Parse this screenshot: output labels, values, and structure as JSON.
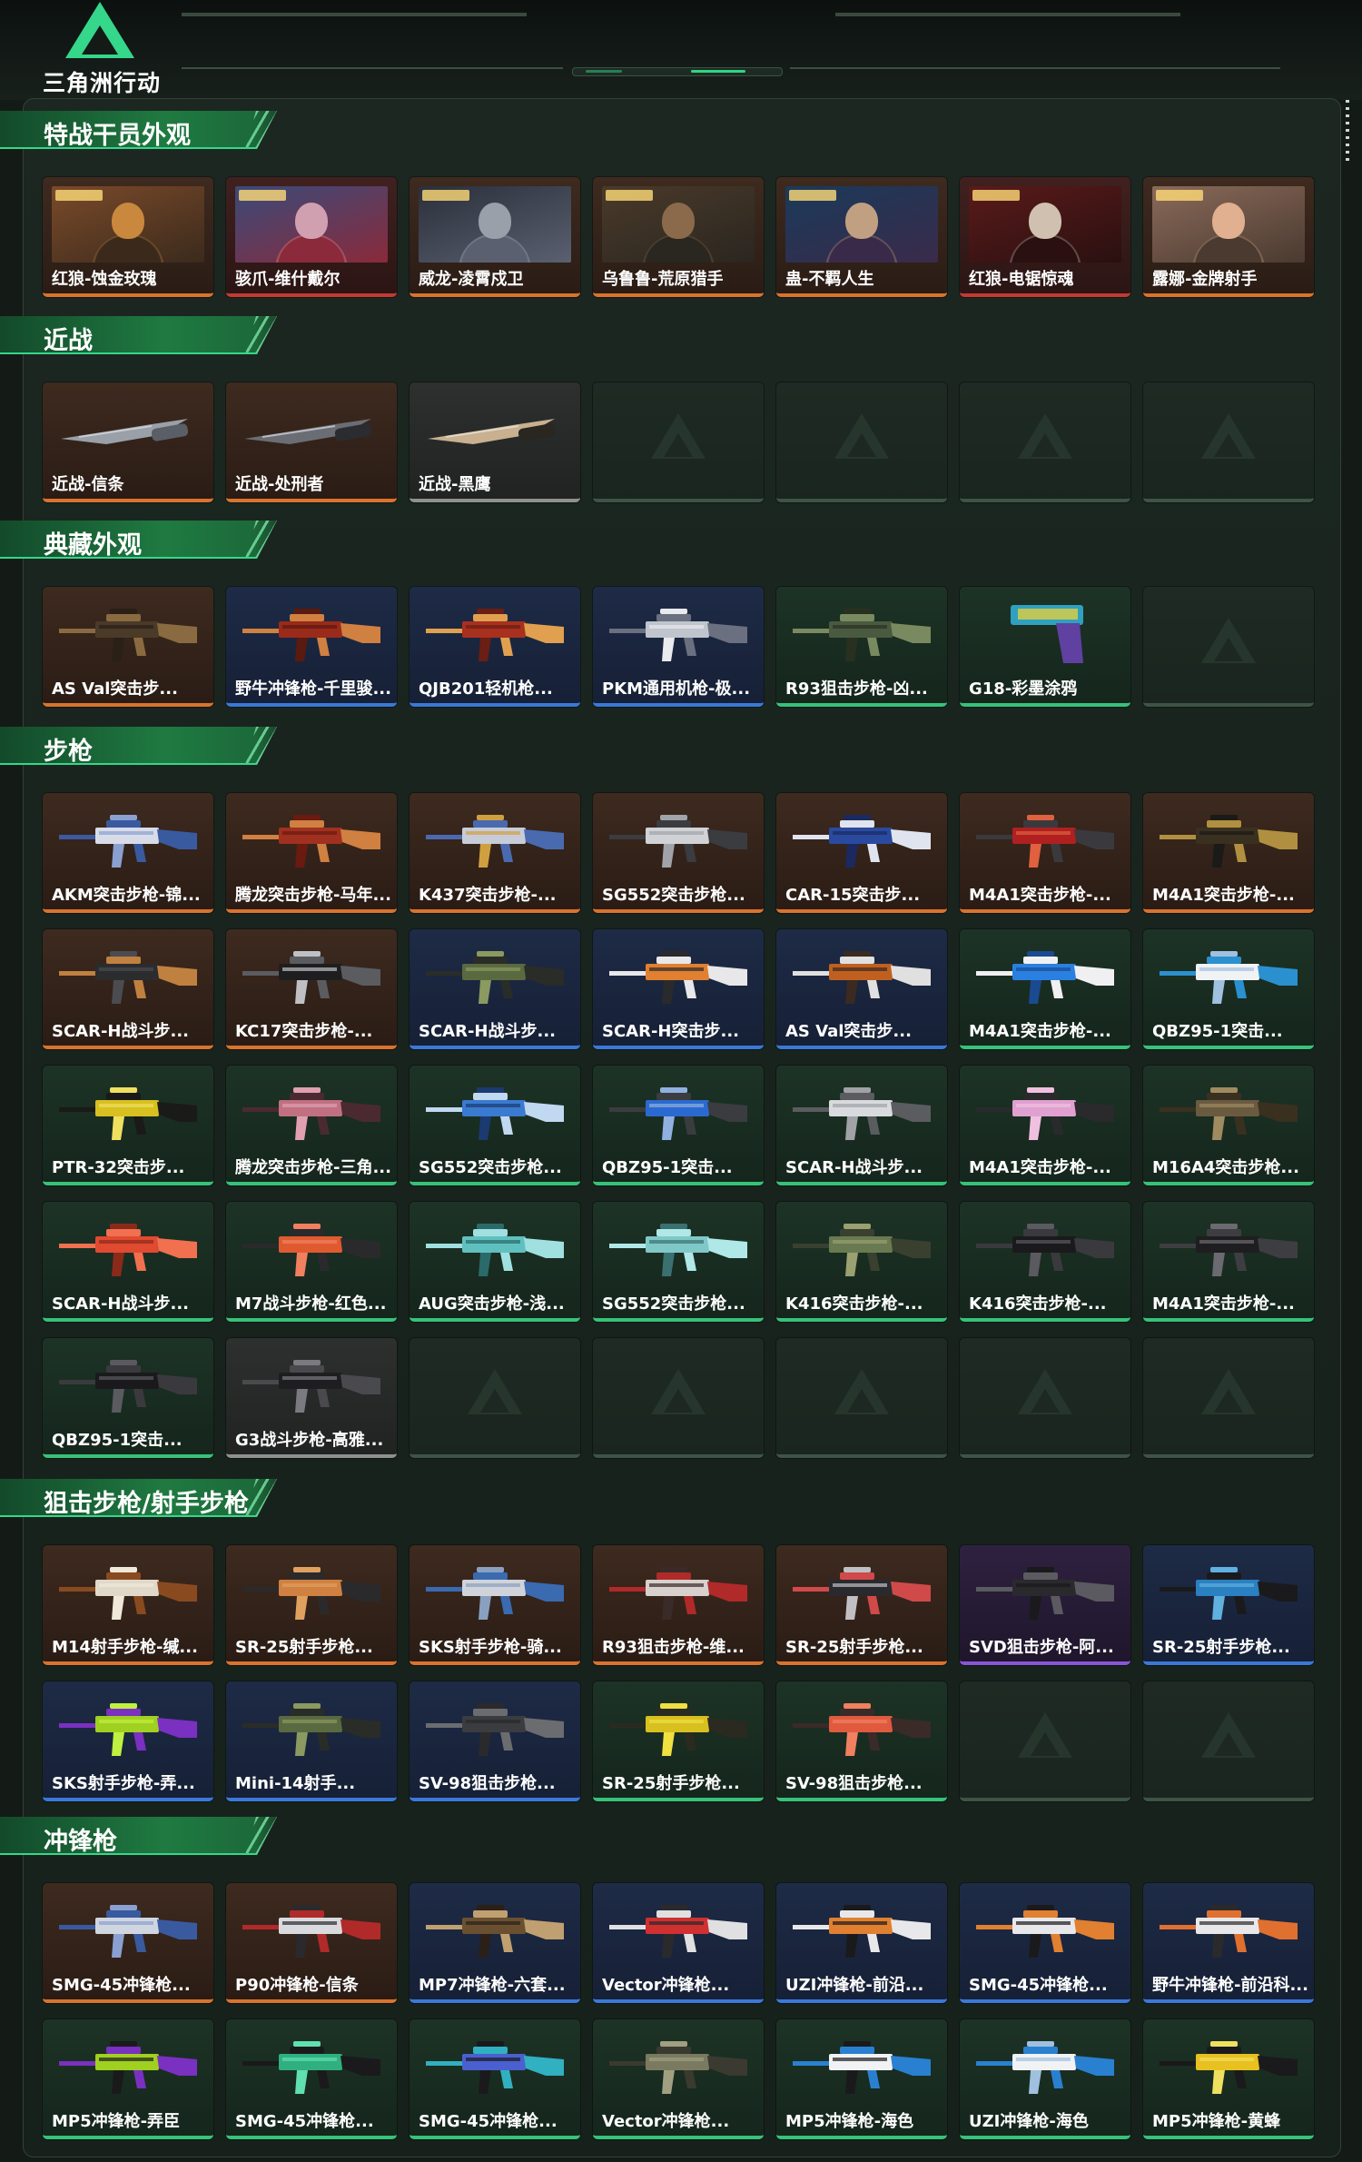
{
  "app": {
    "logo_text": "三角洲行动"
  },
  "colors": {
    "background": "#141b17",
    "accent_green": "#35d78a",
    "quality_orange": "#d9732d",
    "quality_red": "#c23a32",
    "quality_blue": "#3a79d9",
    "quality_purple": "#8a55d9",
    "quality_green": "#37c27a",
    "quality_gray": "#8d928e"
  },
  "sections": [
    {
      "title": "特战干员外观",
      "items": [
        {
          "label": "红狼-蚀金玫瑰",
          "quality": "orange",
          "kind": "operator",
          "art": [
            "#7a4a2a",
            "#c9883e",
            "#3b2a1c"
          ]
        },
        {
          "label": "骇爪-维什戴尔",
          "quality": "red",
          "kind": "operator",
          "art": [
            "#3a4a7a",
            "#d0a0b0",
            "#8a2a3a"
          ]
        },
        {
          "label": "威龙-凌霄戍卫",
          "quality": "orange",
          "kind": "operator",
          "art": [
            "#2a2f3a",
            "#9aa0aa",
            "#5a6070"
          ]
        },
        {
          "label": "乌鲁鲁-荒原猎手",
          "quality": "orange",
          "kind": "operator",
          "art": [
            "#4a3a2a",
            "#8a6a4a",
            "#2a2620"
          ]
        },
        {
          "label": "蛊-不羁人生",
          "quality": "orange",
          "kind": "operator",
          "art": [
            "#1a3a5a",
            "#c0a080",
            "#3a2a4a"
          ]
        },
        {
          "label": "红狼-电锯惊魂",
          "quality": "red",
          "kind": "operator",
          "art": [
            "#5a1a1a",
            "#d0c0b0",
            "#2a1010"
          ]
        },
        {
          "label": "露娜-金牌射手",
          "quality": "orange",
          "kind": "operator",
          "art": [
            "#8a6a5a",
            "#e0b090",
            "#4a3a30"
          ]
        }
      ]
    },
    {
      "title": "近战",
      "items": [
        {
          "label": "近战-信条",
          "quality": "orange",
          "kind": "knife",
          "art": [
            "#9aa0a8",
            "#5a5e66",
            "#c8ccd2"
          ]
        },
        {
          "label": "近战-处刑者",
          "quality": "orange",
          "kind": "knife",
          "art": [
            "#6a6e74",
            "#2a2c30",
            "#b8bcc2"
          ]
        },
        {
          "label": "近战-黑鹰",
          "quality": "gray",
          "kind": "knife",
          "art": [
            "#c8b090",
            "#2a2620",
            "#e0d8c8"
          ]
        },
        {
          "label": "",
          "quality": "empty",
          "kind": "empty"
        },
        {
          "label": "",
          "quality": "empty",
          "kind": "empty"
        },
        {
          "label": "",
          "quality": "empty",
          "kind": "empty"
        },
        {
          "label": "",
          "quality": "empty",
          "kind": "empty"
        }
      ]
    },
    {
      "title": "典藏外观",
      "items": [
        {
          "label": "AS Val突击步...",
          "quality": "orange",
          "kind": "gun",
          "art": [
            "#4a3a28",
            "#8a6a40",
            "#2a2018"
          ]
        },
        {
          "label": "野牛冲锋枪-千里骏...",
          "quality": "blue",
          "kind": "gun",
          "art": [
            "#9a2a1a",
            "#d08040",
            "#5a1a10"
          ]
        },
        {
          "label": "QJB201轻机枪...",
          "quality": "blue",
          "kind": "gun",
          "art": [
            "#a8301e",
            "#e0a050",
            "#6a1e14"
          ]
        },
        {
          "label": "PKM通用机枪-极...",
          "quality": "blue",
          "kind": "gun",
          "art": [
            "#c0c4cc",
            "#6a7080",
            "#e8eaee"
          ]
        },
        {
          "label": "R93狙击步枪-凶...",
          "quality": "green",
          "kind": "gun",
          "art": [
            "#4a5a40",
            "#7a8a60",
            "#2a3020"
          ]
        },
        {
          "label": "G18-彩墨涂鸦",
          "quality": "green",
          "kind": "pistol",
          "art": [
            "#30a0c0",
            "#e0d040",
            "#6040a0"
          ]
        },
        {
          "label": "",
          "quality": "empty",
          "kind": "empty"
        }
      ]
    },
    {
      "title": "步枪",
      "items": [
        {
          "label": "AKM突击步枪-锦...",
          "quality": "orange",
          "kind": "gun",
          "art": [
            "#d8dce8",
            "#3a5aa0",
            "#8aa0d0"
          ]
        },
        {
          "label": "腾龙突击步枪-马年...",
          "quality": "orange",
          "kind": "gun",
          "art": [
            "#a03020",
            "#d08040",
            "#6a1a10"
          ]
        },
        {
          "label": "K437突击步枪-...",
          "quality": "orange",
          "kind": "gun",
          "art": [
            "#c8ccd8",
            "#4a6ab0",
            "#d0a040"
          ]
        },
        {
          "label": "SG552突击步枪...",
          "quality": "orange",
          "kind": "gun",
          "art": [
            "#d0d2d6",
            "#3a3c40",
            "#a0a4aa"
          ]
        },
        {
          "label": "CAR-15突击步...",
          "quality": "orange",
          "kind": "gun",
          "art": [
            "#2a4aa0",
            "#e0e4ee",
            "#1a2a60"
          ]
        },
        {
          "label": "M4A1突击步枪-...",
          "quality": "orange",
          "kind": "gun",
          "art": [
            "#b02020",
            "#3a3a3e",
            "#e06040"
          ]
        },
        {
          "label": "M4A1突击步枪-...",
          "quality": "orange",
          "kind": "gun",
          "art": [
            "#3a3020",
            "#b09040",
            "#1a1a18"
          ]
        },
        {
          "label": "SCAR-H战斗步...",
          "quality": "orange",
          "kind": "gun",
          "art": [
            "#2a2c2e",
            "#c08040",
            "#4a4c50"
          ]
        },
        {
          "label": "KC17突击步枪-...",
          "quality": "orange",
          "kind": "gun",
          "art": [
            "#1e1e20",
            "#5a5c60",
            "#c0c0c4"
          ]
        },
        {
          "label": "SCAR-H战斗步...",
          "quality": "blue",
          "kind": "gun",
          "art": [
            "#5a6a40",
            "#2a2c28",
            "#8a9a60"
          ]
        },
        {
          "label": "SCAR-H突击步...",
          "quality": "blue",
          "kind": "gun",
          "art": [
            "#e08030",
            "#e8e8ea",
            "#2a2a2c"
          ]
        },
        {
          "label": "AS Val突击步...",
          "quality": "blue",
          "kind": "gun",
          "art": [
            "#c06020",
            "#e0e0e0",
            "#3a2a20"
          ]
        },
        {
          "label": "M4A1突击步枪-...",
          "quality": "green",
          "kind": "gun",
          "art": [
            "#2a80e0",
            "#f0f0f2",
            "#1a4a90"
          ]
        },
        {
          "label": "QBZ95-1突击...",
          "quality": "green",
          "kind": "gun",
          "art": [
            "#f0f2f4",
            "#2a90d0",
            "#a0c0e0"
          ]
        },
        {
          "label": "PTR-32突击步...",
          "quality": "green",
          "kind": "gun",
          "art": [
            "#d8c020",
            "#1a1a18",
            "#f0e060"
          ]
        },
        {
          "label": "腾龙突击步枪-三角...",
          "quality": "green",
          "kind": "gun",
          "art": [
            "#c07080",
            "#4a2a30",
            "#e0a0b0"
          ]
        },
        {
          "label": "SG552突击步枪...",
          "quality": "green",
          "kind": "gun",
          "art": [
            "#3a7ad0",
            "#c0d8f0",
            "#1a3a70"
          ]
        },
        {
          "label": "QBZ95-1突击...",
          "quality": "green",
          "kind": "gun",
          "art": [
            "#2a6ad0",
            "#3a3c40",
            "#90b0e0"
          ]
        },
        {
          "label": "SCAR-H战斗步...",
          "quality": "green",
          "kind": "gun",
          "art": [
            "#d8dade",
            "#5a5c60",
            "#a0a2a6"
          ]
        },
        {
          "label": "M4A1突击步枪-...",
          "quality": "green",
          "kind": "gun",
          "art": [
            "#e0a0d0",
            "#2a2a2c",
            "#f0c0e0"
          ]
        },
        {
          "label": "M16A4突击步枪...",
          "quality": "green",
          "kind": "gun",
          "art": [
            "#6a5a40",
            "#3a3020",
            "#a08a60"
          ]
        },
        {
          "label": "SCAR-H战斗步...",
          "quality": "green",
          "kind": "gun",
          "art": [
            "#e04a30",
            "#f07050",
            "#8a2a1a"
          ]
        },
        {
          "label": "M7战斗步枪-红色...",
          "quality": "green",
          "kind": "gun",
          "art": [
            "#e05a30",
            "#2a2a2c",
            "#f08060"
          ]
        },
        {
          "label": "AUG突击步枪-浅...",
          "quality": "green",
          "kind": "gun",
          "art": [
            "#60c0c0",
            "#a0e0e0",
            "#2a6a6a"
          ]
        },
        {
          "label": "SG552突击步枪...",
          "quality": "green",
          "kind": "gun",
          "art": [
            "#80c8c8",
            "#b0e8e8",
            "#3a7070"
          ]
        },
        {
          "label": "K416突击步枪-...",
          "quality": "green",
          "kind": "gun",
          "art": [
            "#6a7a50",
            "#3a4030",
            "#9aa070"
          ]
        },
        {
          "label": "K416突击步枪-...",
          "quality": "green",
          "kind": "gun",
          "art": [
            "#1a1a1c",
            "#3a3a3e",
            "#5a5a60"
          ]
        },
        {
          "label": "M4A1突击步枪-...",
          "quality": "green",
          "kind": "gun",
          "art": [
            "#1e1e20",
            "#3e3e42",
            "#6a6a70"
          ]
        },
        {
          "label": "QBZ95-1突击...",
          "quality": "green",
          "kind": "gun",
          "art": [
            "#1a1a1c",
            "#3a3a3e",
            "#5a5a60"
          ]
        },
        {
          "label": "G3战斗步枪-高雅...",
          "quality": "gray",
          "kind": "gun",
          "art": [
            "#1e1e20",
            "#4a4a4e",
            "#7a7a80"
          ]
        },
        {
          "label": "",
          "quality": "empty",
          "kind": "empty"
        },
        {
          "label": "",
          "quality": "empty",
          "kind": "empty"
        },
        {
          "label": "",
          "quality": "empty",
          "kind": "empty"
        },
        {
          "label": "",
          "quality": "empty",
          "kind": "empty"
        },
        {
          "label": "",
          "quality": "empty",
          "kind": "empty"
        }
      ]
    },
    {
      "title": "狙击步枪/射手步枪",
      "items": [
        {
          "label": "M14射手步枪-缄...",
          "quality": "orange",
          "kind": "gun",
          "art": [
            "#e0d8c8",
            "#8a4a20",
            "#f0e8d8"
          ]
        },
        {
          "label": "SR-25射手步枪...",
          "quality": "orange",
          "kind": "gun",
          "art": [
            "#d08040",
            "#2a2a2c",
            "#e0a060"
          ]
        },
        {
          "label": "SKS射手步枪-骑...",
          "quality": "orange",
          "kind": "gun",
          "art": [
            "#d0d4da",
            "#3a6ab0",
            "#8aa0c0"
          ]
        },
        {
          "label": "R93狙击步枪-维...",
          "quality": "orange",
          "kind": "gun",
          "art": [
            "#d8d0cc",
            "#b02a2a",
            "#3a2a28"
          ]
        },
        {
          "label": "SR-25射手步枪...",
          "quality": "orange",
          "kind": "gun",
          "art": [
            "#2a2a2e",
            "#d04a4a",
            "#c0c0c4"
          ]
        },
        {
          "label": "SVD狙击步枪-阿...",
          "quality": "purple",
          "kind": "gun",
          "art": [
            "#2a2a2e",
            "#5a5a60",
            "#1a1a1c"
          ]
        },
        {
          "label": "SR-25射手步枪...",
          "quality": "blue",
          "kind": "gun",
          "art": [
            "#2a80c0",
            "#1a1a1c",
            "#60b0e0"
          ]
        },
        {
          "label": "SKS射手步枪-弄...",
          "quality": "blue",
          "kind": "gun",
          "art": [
            "#a0d020",
            "#7a30c0",
            "#c0f040"
          ]
        },
        {
          "label": "Mini-14射手...",
          "quality": "blue",
          "kind": "gun",
          "art": [
            "#5a6a40",
            "#2a2c28",
            "#8a9a60"
          ]
        },
        {
          "label": "SV-98狙击步枪...",
          "quality": "blue",
          "kind": "gun",
          "art": [
            "#3a3c40",
            "#6a6c70",
            "#2a2a2c"
          ]
        },
        {
          "label": "SR-25射手步枪...",
          "quality": "green",
          "kind": "gun",
          "art": [
            "#d8c020",
            "#2a2a20",
            "#f0e040"
          ]
        },
        {
          "label": "SV-98狙击步枪...",
          "quality": "green",
          "kind": "gun",
          "art": [
            "#e05a40",
            "#3a2a28",
            "#f08060"
          ]
        },
        {
          "label": "",
          "quality": "empty",
          "kind": "empty"
        },
        {
          "label": "",
          "quality": "empty",
          "kind": "empty"
        }
      ]
    },
    {
      "title": "冲锋枪",
      "items": [
        {
          "label": "SMG-45冲锋枪...",
          "quality": "orange",
          "kind": "gun",
          "art": [
            "#d0d6e0",
            "#3a5aa0",
            "#8aa0d0"
          ]
        },
        {
          "label": "P90冲锋枪-信条",
          "quality": "orange",
          "kind": "gun",
          "art": [
            "#d8dade",
            "#b02a2a",
            "#2a2a2c"
          ]
        },
        {
          "label": "MP7冲锋枪-六套...",
          "quality": "blue",
          "kind": "gun",
          "art": [
            "#6a5030",
            "#c0a070",
            "#2a2018"
          ]
        },
        {
          "label": "Vector冲锋枪...",
          "quality": "blue",
          "kind": "gun",
          "art": [
            "#d03030",
            "#e0e0e2",
            "#2a2a2c"
          ]
        },
        {
          "label": "UZI冲锋枪-前沿...",
          "quality": "blue",
          "kind": "gun",
          "art": [
            "#e08030",
            "#e8e8ea",
            "#1a1a1c"
          ]
        },
        {
          "label": "SMG-45冲锋枪...",
          "quality": "blue",
          "kind": "gun",
          "art": [
            "#e8e8ea",
            "#e08030",
            "#1a1a1c"
          ]
        },
        {
          "label": "野牛冲锋枪-前沿科...",
          "quality": "blue",
          "kind": "gun",
          "art": [
            "#e8e8ea",
            "#e07030",
            "#2a2a2c"
          ]
        },
        {
          "label": "MP5冲锋枪-弄臣",
          "quality": "green",
          "kind": "gun",
          "art": [
            "#a0d020",
            "#7a30c0",
            "#1a1a1c"
          ]
        },
        {
          "label": "SMG-45冲锋枪...",
          "quality": "green",
          "kind": "gun",
          "art": [
            "#30b080",
            "#1a1a1c",
            "#60e0b0"
          ]
        },
        {
          "label": "SMG-45冲锋枪...",
          "quality": "green",
          "kind": "gun",
          "art": [
            "#4a60d0",
            "#30b0c0",
            "#1a1a1c"
          ]
        },
        {
          "label": "Vector冲锋枪...",
          "quality": "green",
          "kind": "gun",
          "art": [
            "#7a7a60",
            "#3a3a30",
            "#a0a080"
          ]
        },
        {
          "label": "MP5冲锋枪-海色",
          "quality": "green",
          "kind": "gun",
          "art": [
            "#f0f2f4",
            "#2a80d0",
            "#1a1a1c"
          ]
        },
        {
          "label": "UZI冲锋枪-海色",
          "quality": "green",
          "kind": "gun",
          "art": [
            "#f0f2f4",
            "#2a80d0",
            "#a0c0e0"
          ]
        },
        {
          "label": "MP5冲锋枪-黄蜂",
          "quality": "green",
          "kind": "gun",
          "art": [
            "#e8c020",
            "#1a1a1c",
            "#f0e060"
          ]
        }
      ]
    }
  ]
}
